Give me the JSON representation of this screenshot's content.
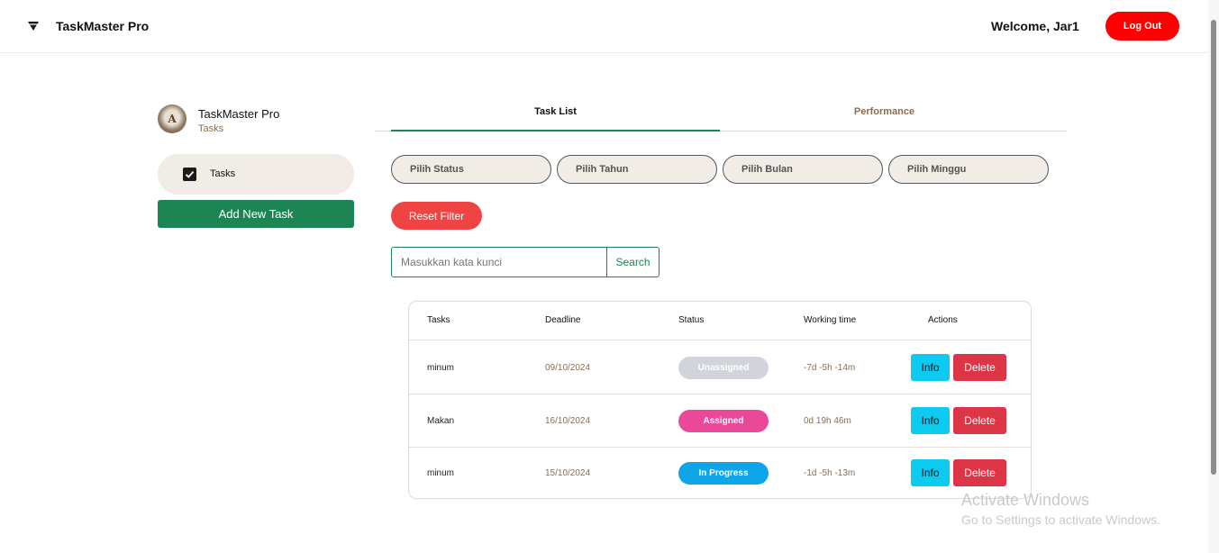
{
  "header": {
    "brand": "TaskMaster Pro",
    "welcome": "Welcome, Jar1",
    "logout_label": "Log Out"
  },
  "sidebar": {
    "profile_name": "TaskMaster Pro",
    "profile_subtitle": "Tasks",
    "avatar_letter": "A",
    "nav_tasks_label": "Tasks",
    "add_task_label": "Add New Task"
  },
  "tabs": [
    {
      "label": "Task List",
      "active": true
    },
    {
      "label": "Performance",
      "active": false
    }
  ],
  "filters": [
    {
      "label": "Pilih Status"
    },
    {
      "label": "Pilih Tahun"
    },
    {
      "label": "Pilih Bulan"
    },
    {
      "label": "Pilih Minggu"
    }
  ],
  "reset_label": "Reset Filter",
  "search": {
    "placeholder": "Masukkan kata kunci",
    "button_label": "Search"
  },
  "table": {
    "columns": [
      "Tasks",
      "Deadline",
      "Status",
      "Working time",
      "Actions"
    ],
    "rows": [
      {
        "task": "minum",
        "deadline": "09/10/2024",
        "status": "Unassigned",
        "working_time": "-7d -5h -14m",
        "info_label": "Info",
        "delete_label": "Delete"
      },
      {
        "task": "Makan",
        "deadline": "16/10/2024",
        "status": "Assigned",
        "working_time": "0d 19h 46m",
        "info_label": "Info",
        "delete_label": "Delete"
      },
      {
        "task": "minum",
        "deadline": "15/10/2024",
        "status": "In Progress",
        "working_time": "-1d -5h -13m",
        "info_label": "Info",
        "delete_label": "Delete"
      }
    ]
  },
  "status_colors": {
    "Unassigned": "#d1d5db",
    "Assigned": "#ec4899",
    "In Progress": "#0ea5e9"
  },
  "colors": {
    "accent_green": "#1c8553",
    "logout_red": "#fe0000",
    "reset_red": "#ef4444",
    "info_cyan": "#0dcaf0",
    "delete_red": "#dc3545"
  },
  "watermark": {
    "title": "Activate Windows",
    "subtitle": "Go to Settings to activate Windows."
  }
}
